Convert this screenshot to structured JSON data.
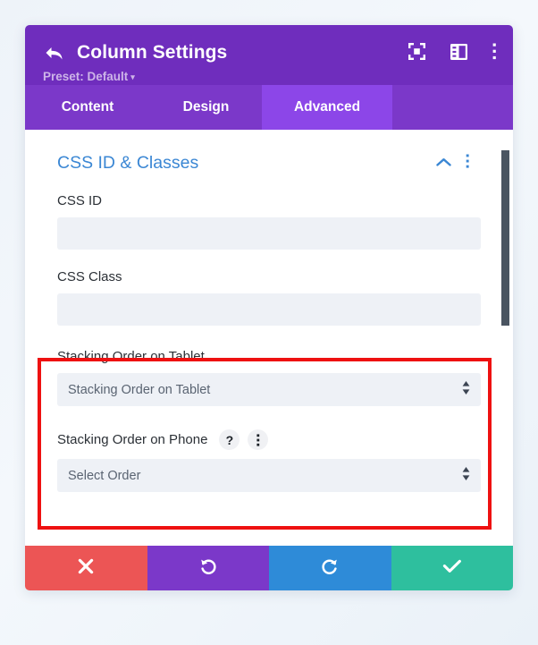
{
  "header": {
    "back_icon": "back-arrow-icon",
    "title": "Column Settings",
    "preset_label": "Preset: Default",
    "preset_caret": "▾",
    "icons": [
      {
        "name": "focus-target-icon"
      },
      {
        "name": "layout-panel-icon"
      },
      {
        "name": "kebab-menu-icon"
      }
    ]
  },
  "tabs": [
    {
      "label": "Content",
      "active": false
    },
    {
      "label": "Design",
      "active": false
    },
    {
      "label": "Advanced",
      "active": true
    }
  ],
  "section": {
    "title": "CSS ID & Classes",
    "collapse_icon": "chevron-up-icon",
    "menu_icon": "kebab-menu-icon"
  },
  "fields": {
    "css_id": {
      "label": "CSS ID",
      "value": "",
      "placeholder": ""
    },
    "css_class": {
      "label": "CSS Class",
      "value": "",
      "placeholder": ""
    },
    "stacking_tablet": {
      "label": "Stacking Order on Tablet",
      "value": "Stacking Order on Tablet"
    },
    "stacking_phone": {
      "label": "Stacking Order on Phone",
      "value": "Select Order",
      "help_icon": "help-question-icon",
      "menu_icon": "kebab-menu-icon"
    }
  },
  "footer": {
    "buttons": [
      {
        "name": "cancel-button",
        "icon": "close-x-icon",
        "color": "#ec5555"
      },
      {
        "name": "undo-button",
        "icon": "undo-icon",
        "color": "#7b38c9"
      },
      {
        "name": "redo-button",
        "icon": "redo-icon",
        "color": "#2e8bd8"
      },
      {
        "name": "save-button",
        "icon": "checkmark-icon",
        "color": "#2ebf9e"
      }
    ]
  },
  "annotation": {
    "highlight_color": "#ee1111"
  }
}
